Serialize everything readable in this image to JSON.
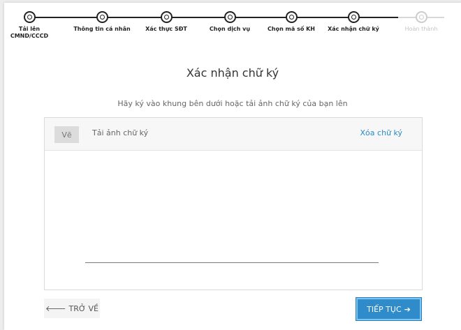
{
  "stepper": {
    "steps": [
      {
        "label_1": "Tải lên",
        "label_2": "CMND/CCCD",
        "state": "done"
      },
      {
        "label_1": "Thông tin cá nhân",
        "state": "done"
      },
      {
        "label_1": "Xác thực SĐT",
        "state": "done"
      },
      {
        "label_1": "Chọn dịch vụ",
        "state": "done"
      },
      {
        "label_1": "Chọn mã số KH",
        "state": "done"
      },
      {
        "label_1": "Xác nhận chữ ký",
        "state": "done"
      },
      {
        "label_1": "Hoàn thành",
        "state": "todo"
      }
    ]
  },
  "page": {
    "title": "Xác nhận chữ ký",
    "subtitle": "Hãy ký vào khung bên dưới hoặc tải ảnh chữ ký của bạn lên"
  },
  "signature": {
    "tab_draw": "Vẽ",
    "tab_upload": "Tải ảnh chữ ký",
    "clear": "Xóa chữ ký"
  },
  "actions": {
    "back_arrow": "🡐",
    "back_label": "TRỞ VỀ",
    "next_label": "TIẾP TỤC",
    "next_arrow": "➔"
  },
  "colors": {
    "accent": "#2f8bc9",
    "link": "#2a8ac6"
  }
}
